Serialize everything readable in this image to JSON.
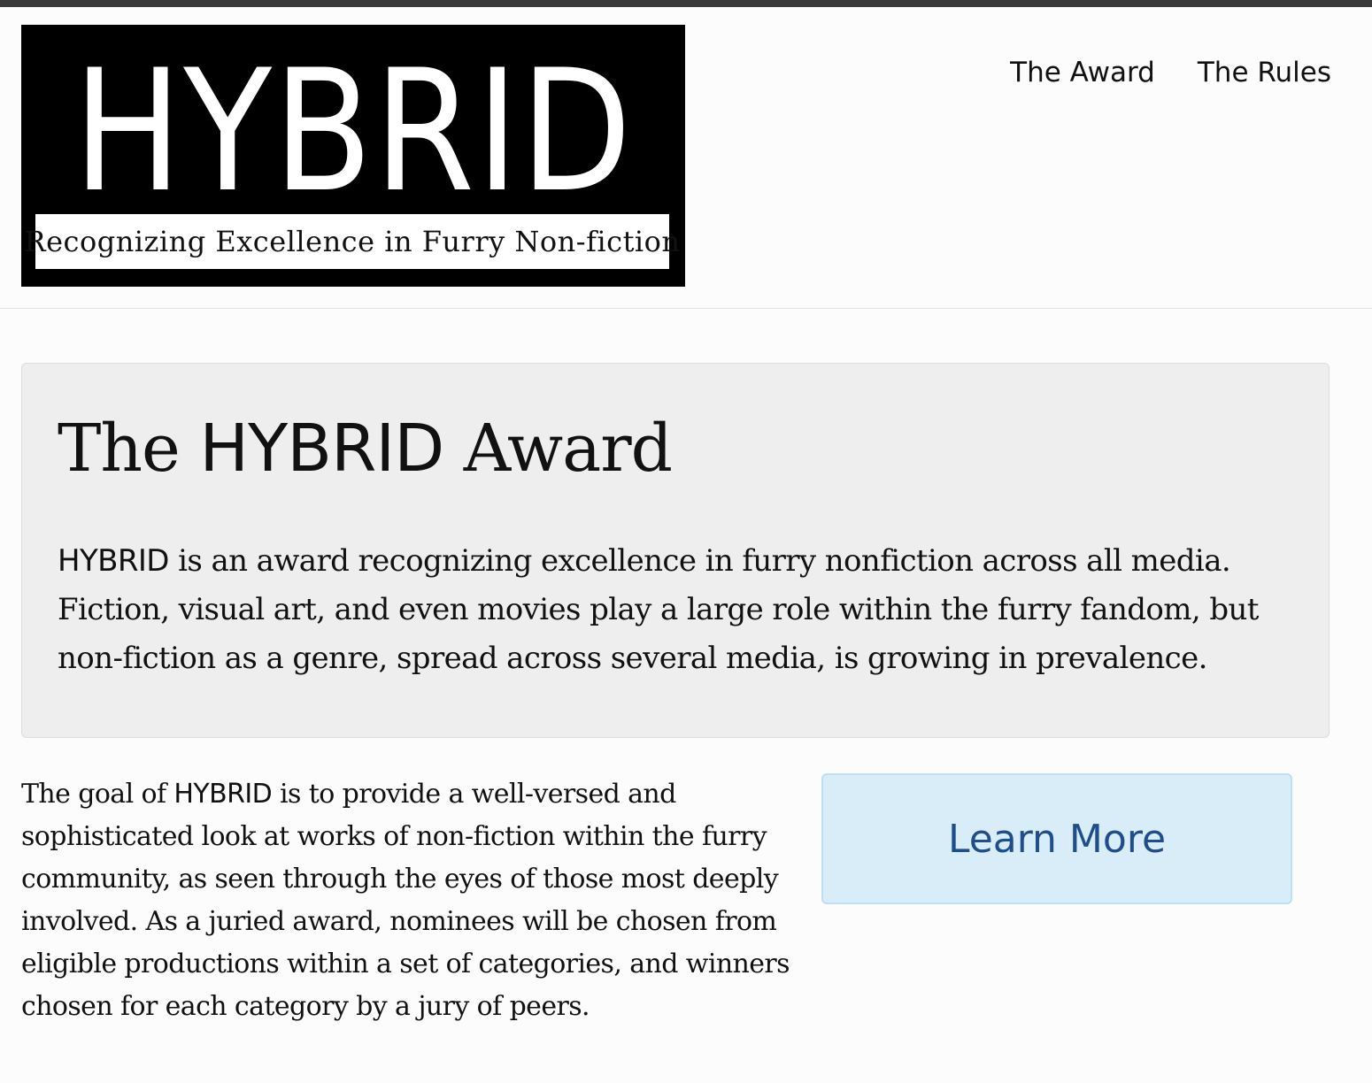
{
  "logo": {
    "wordmark": "HYBRID",
    "tagline": "Recognizing Excellence in Furry Non-fiction"
  },
  "nav": {
    "items": [
      {
        "label": "The Award"
      },
      {
        "label": "The Rules"
      }
    ]
  },
  "jumbotron": {
    "title_prefix": "The ",
    "title_brand": "HYBRID",
    "title_suffix": " Award",
    "text_brand": "HYBRID",
    "text_rest": " is an award recognizing excellence in furry nonfiction across all media. Fiction, visual art, and even movies play a large role within the furry fandom, but non-fiction as a genre, spread across several media, is growing in prevalence."
  },
  "goal": {
    "text_prefix": "The goal of ",
    "text_brand": "HYBRID",
    "text_rest": " is to provide a well-versed and sophisticated look at works of non-fiction within the furry community, as seen through the eyes of those most deeply involved. As a juried award, nominees will be chosen from eligible productions within a set of categories, and winners chosen for each category by a jury of peers."
  },
  "cta": {
    "label": "Learn More"
  },
  "colors": {
    "page_background": "#fcfcfc",
    "jumbotron_background": "#eeeeee",
    "button_background": "#d9edf8",
    "button_border": "#bcdff1",
    "button_text": "#1f4e8c",
    "logo_background": "#000000"
  }
}
